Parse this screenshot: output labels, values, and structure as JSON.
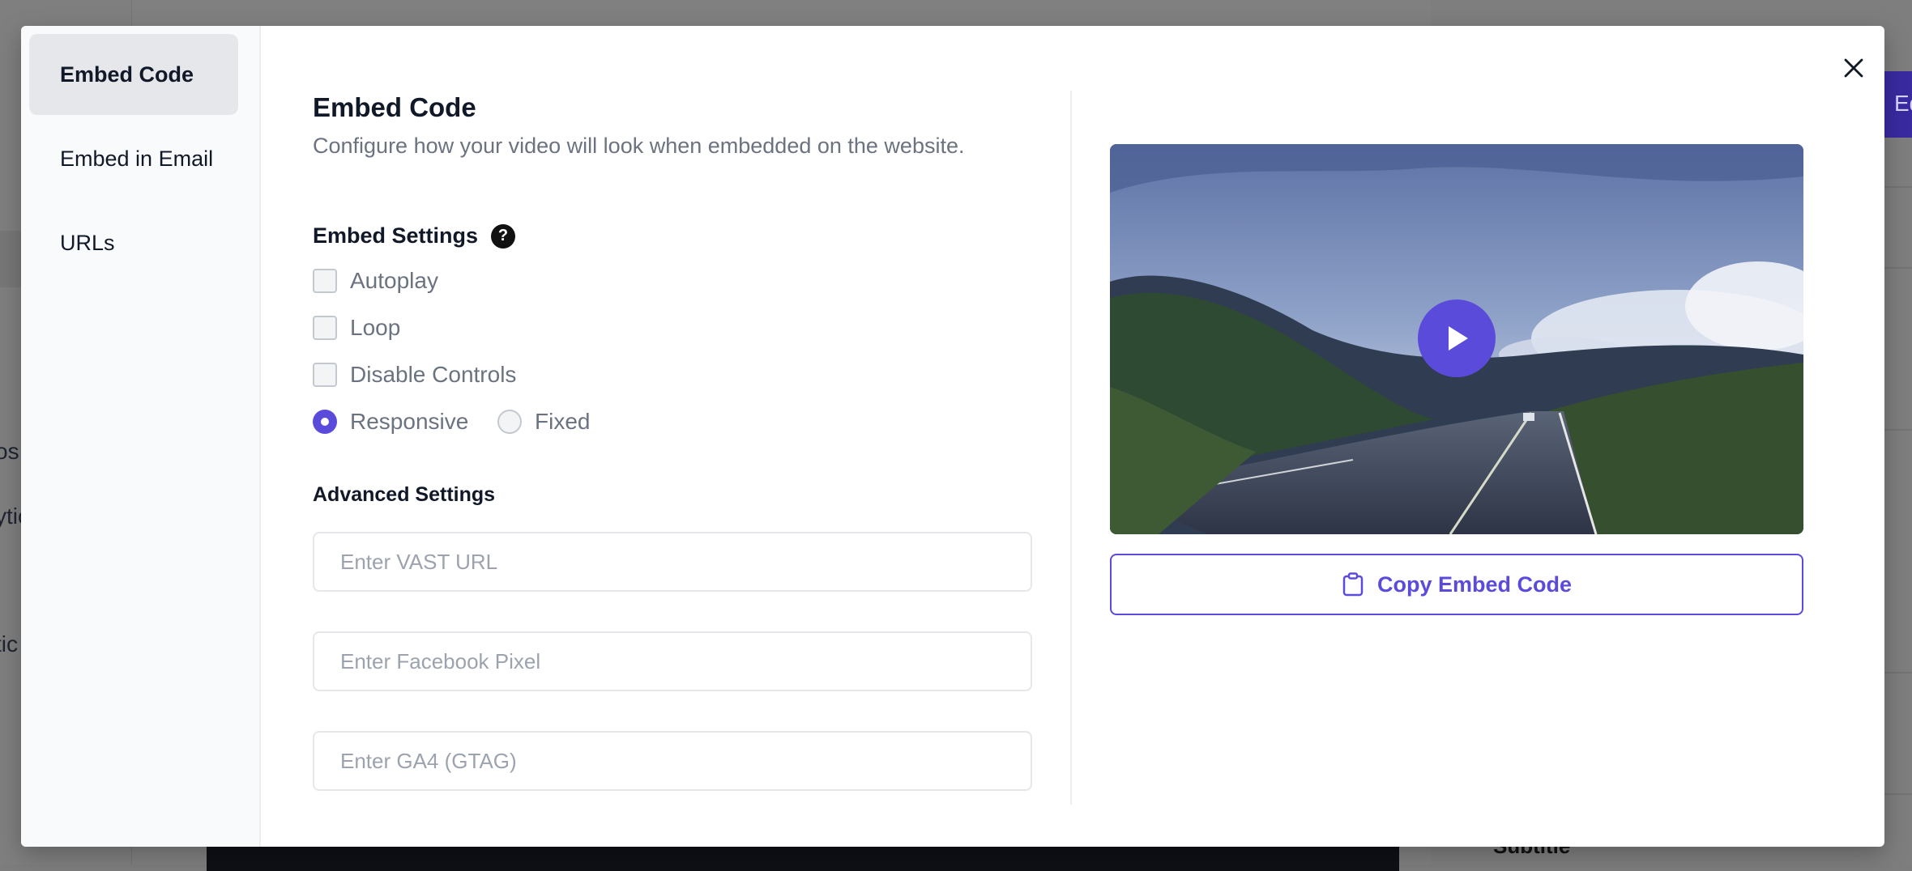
{
  "background": {
    "nav_fragments": [
      "os",
      "ytic",
      "tic"
    ],
    "header_button_fragment": "Ed",
    "subtitle_label": "Subtitle"
  },
  "modal": {
    "sidebar": {
      "items": [
        {
          "label": "Embed Code",
          "active": true
        },
        {
          "label": "Embed in Email",
          "active": false
        },
        {
          "label": "URLs",
          "active": false
        }
      ]
    },
    "title": "Embed Code",
    "description": "Configure how your video will look when embedded on the website.",
    "embed_settings": {
      "title": "Embed Settings",
      "help_icon": "?",
      "options": {
        "autoplay": {
          "label": "Autoplay",
          "checked": false
        },
        "loop": {
          "label": "Loop",
          "checked": false
        },
        "disable_controls": {
          "label": "Disable Controls",
          "checked": false
        }
      },
      "size_mode": {
        "responsive": {
          "label": "Responsive",
          "selected": true
        },
        "fixed": {
          "label": "Fixed",
          "selected": false
        }
      }
    },
    "advanced_settings": {
      "title": "Advanced Settings",
      "vast_url": {
        "value": "",
        "placeholder": "Enter VAST URL"
      },
      "facebook_pixel": {
        "value": "",
        "placeholder": "Enter Facebook Pixel"
      },
      "ga4": {
        "value": "",
        "placeholder": "Enter GA4 (GTAG)"
      }
    },
    "copy_button": {
      "label": "Copy Embed Code",
      "icon": "clipboard-icon"
    },
    "close_icon": "close-icon",
    "colors": {
      "accent": "#5b4bdb",
      "text": "#111827",
      "muted": "#6b7280"
    }
  }
}
